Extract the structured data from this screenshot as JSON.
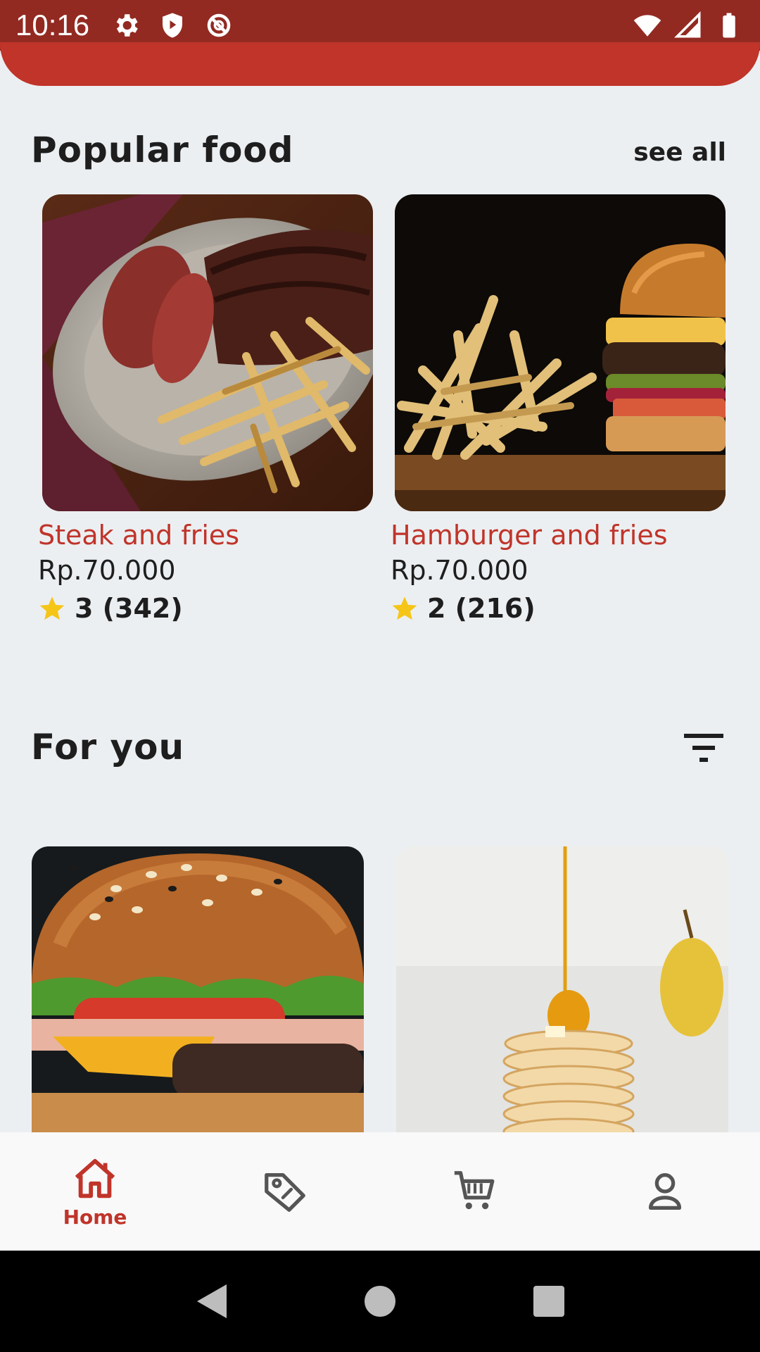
{
  "status_bar": {
    "time": "10:16",
    "left_icons": [
      "gear-icon",
      "shield-play-icon",
      "no-sync-icon"
    ],
    "right_icons": [
      "wifi-icon",
      "signal-icon",
      "battery-icon"
    ]
  },
  "popular": {
    "title": "Popular food",
    "see_all": "see all",
    "items": [
      {
        "name": "Steak and fries",
        "price": "Rp.70.000",
        "rating": "3 (342)"
      },
      {
        "name": "Hamburger and fries",
        "price": "Rp.70.000",
        "rating": "2 (216)"
      }
    ]
  },
  "for_you": {
    "title": "For you"
  },
  "bottom_nav": {
    "home_label": "Home",
    "items": [
      "home-icon",
      "tag-icon",
      "cart-icon",
      "profile-icon"
    ]
  },
  "colors": {
    "brand_red": "#C0342A",
    "status_bar": "#922A22",
    "star": "#F5C518",
    "background": "#ECEFF1"
  }
}
